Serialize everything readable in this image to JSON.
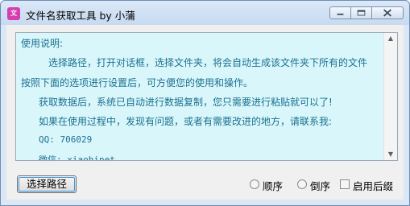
{
  "window": {
    "title": "文件名获取工具 by 小蒲",
    "icon_text": "文"
  },
  "instructions": {
    "heading": "使用说明:",
    "lines": [
      "选择路径，打开对话框，选择文件夹，将会自动生成该文件夹下所有的文件",
      "按照下面的选项进行设置后，可方便您的使用和操作。",
      "获取数据后，系统已自动进行数据复制，您只需要进行粘贴就可以了!",
      "如果在使用过程中，发现有问题，或者有需要改进的地方，请联系我:",
      "QQ: 706029",
      "微信: xiaohinet"
    ]
  },
  "controls": {
    "select_path_label": "选择路径",
    "order_asc_label": "顺序",
    "order_desc_label": "倒序",
    "enable_suffix_label": "启用后缀"
  }
}
